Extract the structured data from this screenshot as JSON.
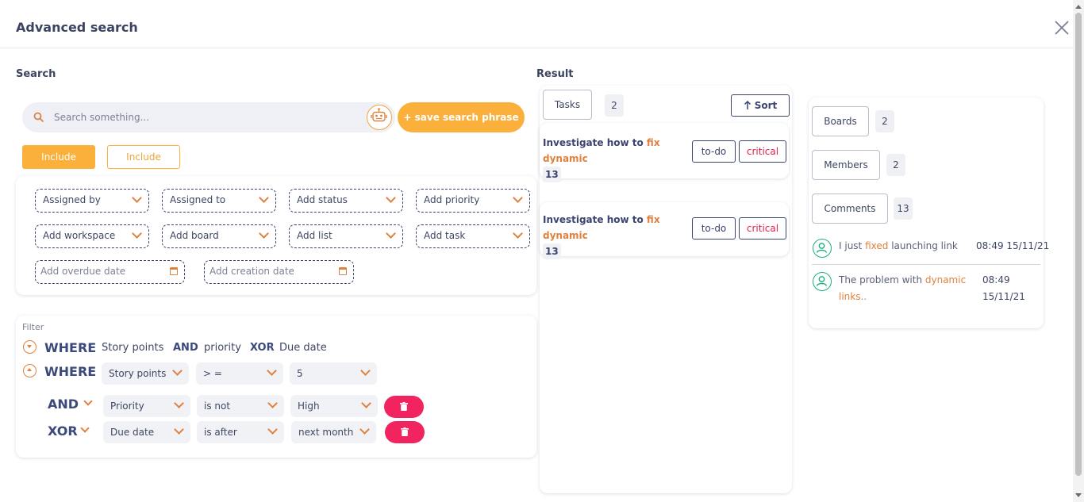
{
  "dialog": {
    "title": "Advanced search"
  },
  "search": {
    "section_label": "Search",
    "placeholder": "Search something...",
    "save_label": "+ save search phrase",
    "include_solid": "Include",
    "include_outline": "Include"
  },
  "fields": {
    "assigned_by": "Assigned by",
    "assigned_to": "Assigned to",
    "add_status": "Add status",
    "add_priority": "Add priority",
    "add_workspace": "Add workspace",
    "add_board": "Add board",
    "add_list": "Add list",
    "add_task": "Add task",
    "add_overdue_date": "Add overdue date",
    "add_creation_date": "Add creation date"
  },
  "filter": {
    "label": "Filter",
    "summary": {
      "where": "WHERE",
      "field1": "Story points",
      "op1": "AND",
      "field2": "priority",
      "op2": "XOR",
      "field3": "Due date"
    },
    "where_row": {
      "keyword": "WHERE",
      "field": "Story points",
      "operator": "> =",
      "value": "5"
    },
    "and_row": {
      "keyword": "AND",
      "field": "Priority",
      "operator": "is not",
      "value": "High"
    },
    "xor_row": {
      "keyword": "XOR",
      "field": "Due date",
      "operator": "is after",
      "value": "next month"
    }
  },
  "result": {
    "section_label": "Result",
    "tasks_label": "Tasks",
    "tasks_count": "2",
    "sort_label": "Sort",
    "tasks": [
      {
        "prefix": "Investigate how to ",
        "hl1": "fix",
        "hl2": "dynamic",
        "suffix": "13",
        "status": "to-do",
        "priority": "critical"
      },
      {
        "prefix": "Investigate how to ",
        "hl1": "fix",
        "hl2": "dynamic",
        "suffix": "13",
        "status": "to-do",
        "priority": "critical"
      }
    ],
    "boards_label": "Boards",
    "boards_count": "2",
    "members_label": "Members",
    "members_count": "2",
    "comments_label": "Comments",
    "comments_count": "13",
    "comments": [
      {
        "pre": "I just ",
        "hl": "fixed",
        "post": " launching link",
        "time": "08:49 15/11/21"
      },
      {
        "pre": "The problem with ",
        "hl": "dynamic",
        "post": "",
        "hl2": "links..",
        "time1": "08:49",
        "time2": "15/11/21"
      }
    ]
  },
  "colors": {
    "accent": "#fbb03b",
    "navy": "#3b4470",
    "danger": "#f2245f",
    "success": "#19b07a"
  }
}
